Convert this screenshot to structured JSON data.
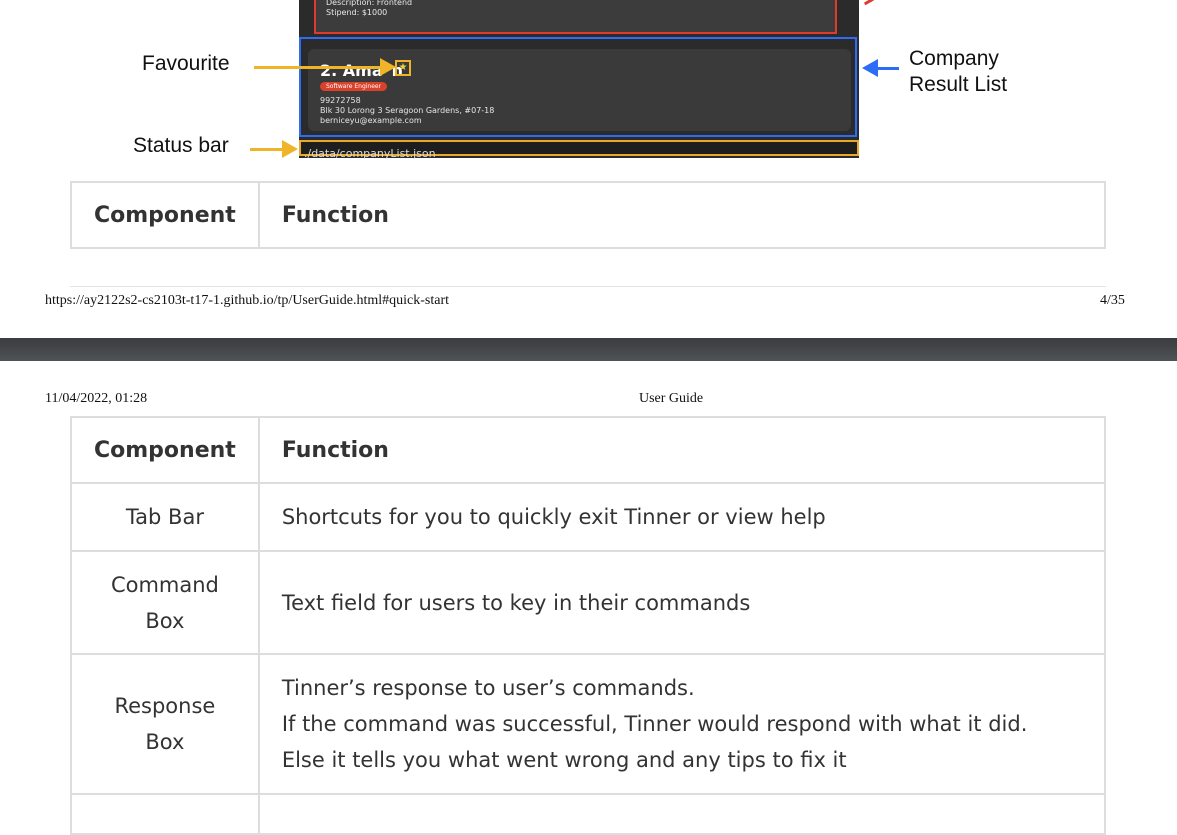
{
  "app_screenshot": {
    "prev_card_lines": [
      "Description: Frontend",
      "Stipend: $1000"
    ],
    "card_title": "2. Ama",
    "card_title_tail": "n",
    "role_tag": "Software Engineer",
    "phone": "99272758",
    "address": "Blk 30 Lorong 3 Seragoon Gardens, #07-18",
    "email": "berniceyu@example.com",
    "status_path": "./data/companyList.json"
  },
  "annotations": {
    "favourite": "Favourite",
    "status_bar": "Status bar",
    "result_list_line1": "Company",
    "result_list_line2": "Result List"
  },
  "table_top": {
    "headers": [
      "Component",
      "Function"
    ]
  },
  "page_footer": {
    "url": "https://ay2122s2-cs2103t-t17-1.github.io/tp/UserGuide.html#quick-start",
    "page": "4/35"
  },
  "page_header": {
    "datetime": "11/04/2022, 01:28",
    "title": "User Guide"
  },
  "table": {
    "headers": [
      "Component",
      "Function"
    ],
    "rows": [
      {
        "component": "Tab Bar",
        "function_lines": [
          "Shortcuts for you to quickly exit Tinner or view help"
        ]
      },
      {
        "component": "Command Box",
        "function_lines": [
          "Text field for users to key in their commands"
        ]
      },
      {
        "component": "Response Box",
        "function_lines": [
          "Tinner’s response to user’s commands.",
          "If the command was successful, Tinner would respond with what it did.",
          "Else it tells you what went wrong and any tips to fix it"
        ]
      }
    ]
  },
  "colors": {
    "annotation_yellow": "#f0b429",
    "annotation_blue": "#2d6cf5",
    "annotation_red": "#e03a2f"
  }
}
